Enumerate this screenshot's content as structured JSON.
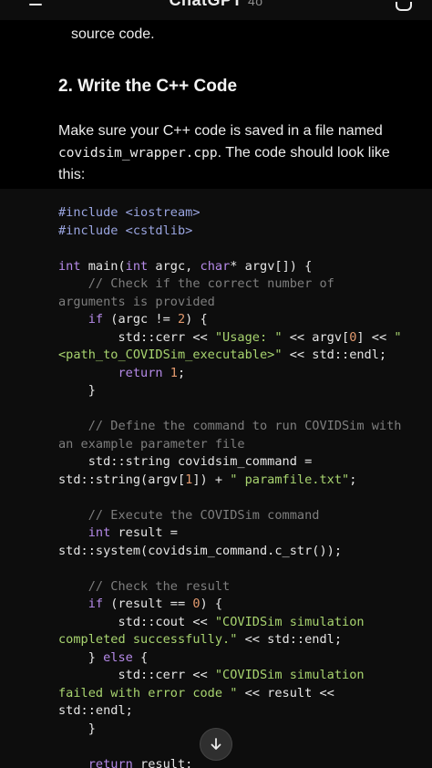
{
  "header": {
    "title": "ChatGPT",
    "model": "4o"
  },
  "previous": {
    "text": "source code."
  },
  "section": {
    "heading": "2. Write the C++ Code",
    "paragraph_before": "Make sure your C++ code is saved in a file named ",
    "filename": "covidsim_wrapper.cpp",
    "paragraph_after": ". The code should look like this:"
  },
  "code": {
    "lines": [
      "#include <iostream>",
      "#include <cstdlib>",
      "",
      "int main(int argc, char* argv[]) {",
      "    // Check if the correct number of",
      "arguments is provided",
      "    if (argc != 2) {",
      "        std::cerr << \"Usage: \" << argv[0] << \"",
      "<path_to_COVIDSim_executable>\" << std::endl;",
      "        return 1;",
      "    }",
      "",
      "    // Define the command to run COVIDSim with",
      "an example parameter file",
      "    std::string covidsim_command =",
      "std::string(argv[1]) + \" paramfile.txt\";",
      "",
      "    // Execute the COVIDSim command",
      "    int result =",
      "std::system(covidsim_command.c_str());",
      "",
      "    // Check the result",
      "    if (result == 0) {",
      "        std::cout << \"COVIDSim simulation",
      "completed successfully.\" << std::endl;",
      "    } else {",
      "        std::cerr << \"COVIDSim simulation",
      "failed with error code \" << result <<",
      "std::endl;",
      "    }",
      "",
      "    return result;"
    ]
  },
  "icons": {
    "menu": "menu-icon",
    "new_chat": "new-chat-icon",
    "scroll_down": "arrow-down-icon"
  },
  "colors": {
    "background": "#000000",
    "code_background": "#0d0d0d",
    "keyword": "#b58ae8",
    "string": "#a8d46f",
    "number": "#e39a6e",
    "comment": "#7e7e7e",
    "preprocessor": "#9aa5e0"
  }
}
